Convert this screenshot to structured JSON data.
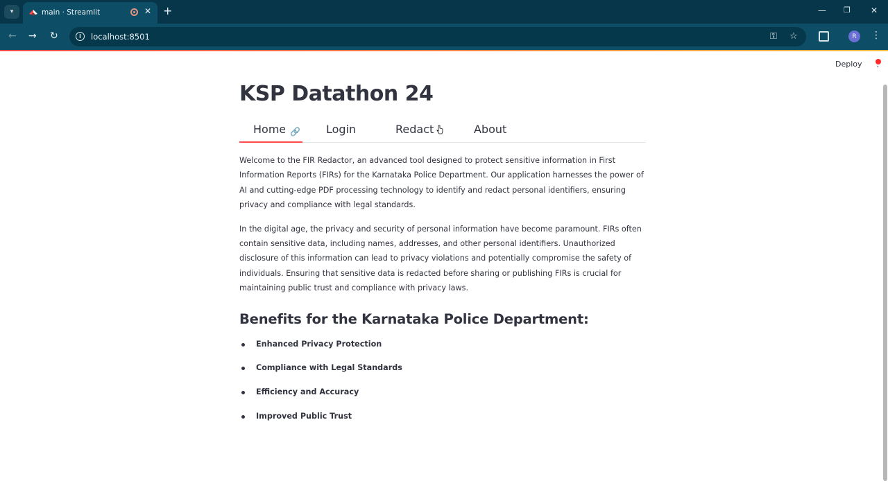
{
  "browser": {
    "tab_title": "main · Streamlit",
    "url": "localhost:8501",
    "profile_initial": "R"
  },
  "header": {
    "deploy_label": "Deploy"
  },
  "page": {
    "title": "KSP Datathon 24"
  },
  "tabs": [
    {
      "label": "Home"
    },
    {
      "label": "Login"
    },
    {
      "label": "Redact"
    },
    {
      "label": "About"
    }
  ],
  "content": {
    "intro": "Welcome to the FIR Redactor, an advanced tool designed to protect sensitive information in First Information Reports (FIRs) for the Karnataka Police Department. Our application harnesses the power of AI and cutting-edge PDF processing technology to identify and redact personal identifiers, ensuring privacy and compliance with legal standards.",
    "context": "In the digital age, the privacy and security of personal information have become paramount. FIRs often contain sensitive data, including names, addresses, and other personal identifiers. Unauthorized disclosure of this information can lead to privacy violations and potentially compromise the safety of individuals. Ensuring that sensitive data is redacted before sharing or publishing FIRs is crucial for maintaining public trust and compliance with privacy laws.",
    "benefits_heading": "Benefits for the Karnataka Police Department:",
    "benefits": [
      "Enhanced Privacy Protection",
      "Compliance with Legal Standards",
      "Efficiency and Accuracy",
      "Improved Public Trust"
    ]
  },
  "colors": {
    "accent": "#ff4b4b",
    "text": "#31333f",
    "chrome_dark": "#07364a",
    "chrome": "#0e4d66"
  }
}
